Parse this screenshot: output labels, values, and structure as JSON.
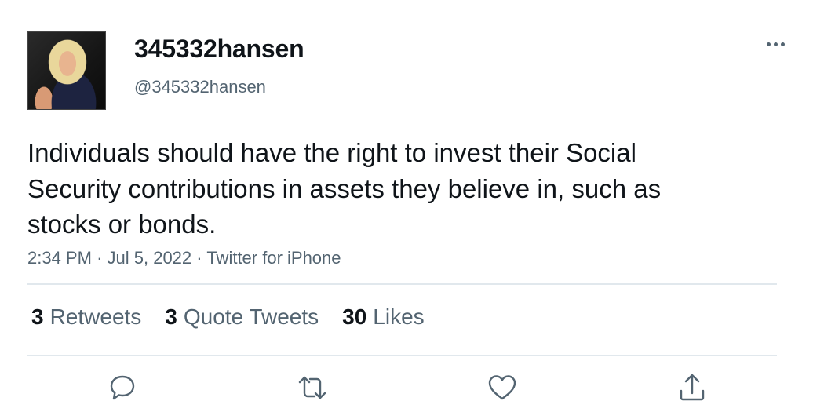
{
  "tweet": {
    "author": {
      "display_name": "345332hansen",
      "handle": "@345332hansen"
    },
    "text": "Individuals should have the right to invest their Social Security contributions in assets they believe in, such as stocks or bonds.",
    "time": "2:34 PM",
    "date": "Jul 5, 2022",
    "source": "Twitter for iPhone",
    "separator": "·",
    "stats": {
      "retweets_count": "3",
      "retweets_label": "Retweets",
      "quotes_count": "3",
      "quotes_label": "Quote Tweets",
      "likes_count": "30",
      "likes_label": "Likes"
    }
  },
  "icons": {
    "more": "more-horizontal-icon",
    "reply": "reply-bubble-icon",
    "retweet": "retweet-arrows-icon",
    "like": "heart-icon",
    "share": "share-upload-icon"
  },
  "colors": {
    "text_primary": "#0f1419",
    "text_secondary": "#536471",
    "divider": "#e1e8ed",
    "background": "#ffffff"
  }
}
